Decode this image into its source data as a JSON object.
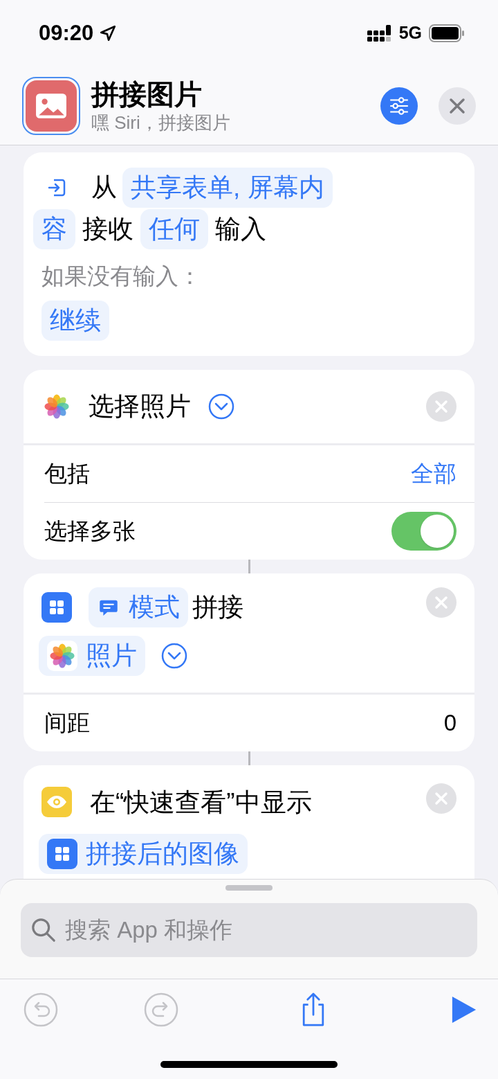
{
  "status_bar": {
    "time": "09:20",
    "network": "5G"
  },
  "header": {
    "title": "拼接图片",
    "subtitle": "嘿 Siri，拼接图片"
  },
  "actions": [
    {
      "kind": "receive",
      "lines": [
        [
          {
            "kind": "text",
            "text": "从"
          },
          {
            "kind": "token",
            "text": "共享表单, 屏幕内"
          }
        ],
        [
          {
            "kind": "token",
            "text": "容"
          },
          {
            "kind": "text",
            "text": "接收"
          },
          {
            "kind": "token",
            "text": "任何"
          },
          {
            "kind": "text",
            "text": "输入"
          }
        ]
      ],
      "note": "如果没有输入：",
      "fallback": "继续"
    },
    {
      "kind": "select_photos",
      "title": "选择照片",
      "rows": [
        {
          "kind": "value",
          "label": "包括",
          "value": "全部"
        },
        {
          "kind": "toggle",
          "label": "选择多张",
          "on": true
        }
      ]
    },
    {
      "kind": "combine",
      "mode": "模式",
      "verb": "拼接",
      "input": "照片",
      "rows": [
        {
          "kind": "number",
          "label": "间距",
          "value": "0"
        }
      ]
    },
    {
      "kind": "quicklook",
      "title": "在“快速查看”中显示",
      "input": "拼接后的图像"
    }
  ],
  "search": {
    "placeholder": "搜索 App 和操作"
  },
  "toolbar": [
    {
      "kind": "undo",
      "disabled": true
    },
    {
      "kind": "redo",
      "disabled": true
    },
    {
      "kind": "share",
      "disabled": false
    },
    {
      "kind": "play",
      "disabled": false
    }
  ]
}
